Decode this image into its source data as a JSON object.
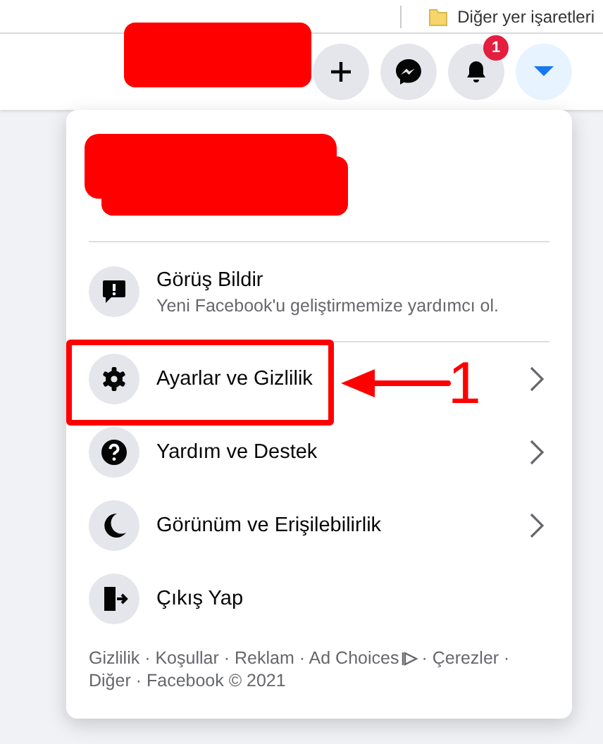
{
  "bookmarks_bar": {
    "folder": "Diğer yer işaretleri"
  },
  "header": {
    "buttons": [
      {
        "kind": "plus",
        "selected": false
      },
      {
        "kind": "messenger",
        "selected": false
      },
      {
        "kind": "bell",
        "selected": false,
        "badge": "1"
      },
      {
        "kind": "caret",
        "selected": true
      }
    ]
  },
  "menu": {
    "items": [
      {
        "kind": "feedback",
        "title": "Görüş Bildir",
        "subtitle": "Yeni Facebook'u geliştirmemize yardımcı ol.",
        "chevron": false
      },
      {
        "kind": "settings",
        "title": "Ayarlar ve Gizlilik",
        "chevron": true
      },
      {
        "kind": "help",
        "title": "Yardım ve Destek",
        "chevron": true
      },
      {
        "kind": "display",
        "title": "Görünüm ve Erişilebilirlik",
        "chevron": true
      },
      {
        "kind": "logout",
        "title": "Çıkış Yap",
        "chevron": false
      }
    ],
    "footer": [
      "Gizlilik · Koşullar · Reklam · Ad Choices",
      "· Çerezler ·",
      "Diğer · Facebook © 2021"
    ]
  },
  "annotation": {
    "label": "1"
  }
}
